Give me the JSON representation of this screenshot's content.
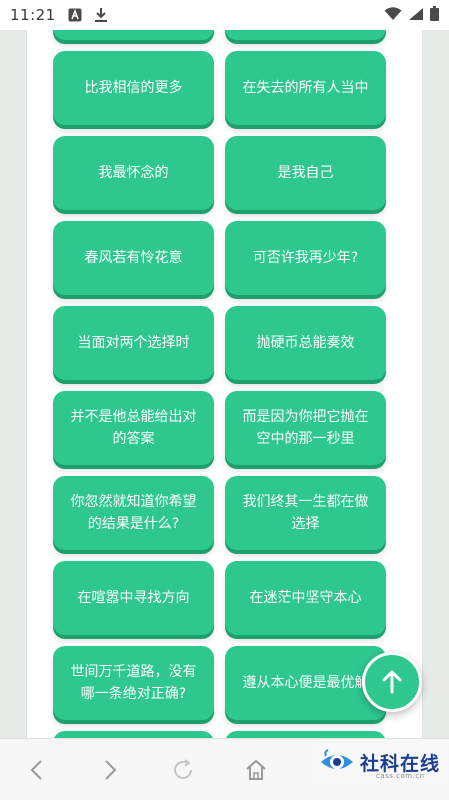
{
  "status_bar": {
    "time": "11:21",
    "icons_left": [
      "a-badge-icon",
      "download-icon"
    ],
    "icons_right": [
      "wifi-icon",
      "signal-icon",
      "battery-icon"
    ]
  },
  "cards": [
    {
      "lines": [
        ""
      ]
    },
    {
      "lines": [
        ""
      ]
    },
    {
      "lines": [
        "比我相信的更多"
      ]
    },
    {
      "lines": [
        "在失去的所有人当中"
      ]
    },
    {
      "lines": [
        "我最怀念的"
      ]
    },
    {
      "lines": [
        "是我自己"
      ]
    },
    {
      "lines": [
        "春风若有怜花意"
      ]
    },
    {
      "lines": [
        "可否许我再少年?"
      ]
    },
    {
      "lines": [
        "当面对两个选择时"
      ]
    },
    {
      "lines": [
        "抛硬币总能奏效"
      ]
    },
    {
      "lines": [
        "并不是他总能给出对",
        "的答案"
      ]
    },
    {
      "lines": [
        "而是因为你把它抛在",
        "空中的那一秒里"
      ]
    },
    {
      "lines": [
        "你忽然就知道你希望",
        "的结果是什么?"
      ]
    },
    {
      "lines": [
        "我们终其一生都在做",
        "选择"
      ]
    },
    {
      "lines": [
        "在喧嚣中寻找方向"
      ]
    },
    {
      "lines": [
        "在迷茫中坚守本心"
      ]
    },
    {
      "lines": [
        "世间万千道路，没有",
        "哪一条绝对正确?"
      ]
    },
    {
      "lines": [
        "遵从本心便是最优解"
      ]
    },
    {
      "lines": [
        ""
      ]
    },
    {
      "lines": [
        ""
      ]
    }
  ],
  "fab": {
    "icon": "arrow-up-icon"
  },
  "nav_bar": {
    "buttons": [
      "back-icon",
      "forward-icon",
      "refresh-icon",
      "home-icon"
    ]
  },
  "watermark": {
    "text": "社科在线",
    "sub": "cass.com.cn"
  },
  "colors": {
    "card": "#2ec78e",
    "card_shadow": "#1f9e6e",
    "background": "#e6ebe8",
    "watermark": "#1b3f8f"
  }
}
